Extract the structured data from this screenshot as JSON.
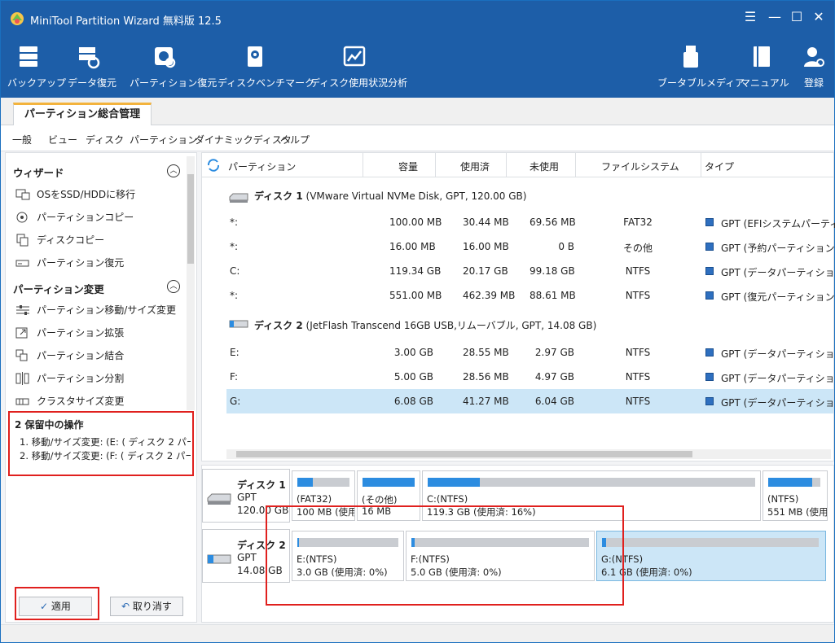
{
  "window": {
    "title": "MiniTool Partition Wizard 無料版 12.5"
  },
  "window_controls": {
    "menu": "☰",
    "minimize": "—",
    "maximize": "☐",
    "close": "✕"
  },
  "toolbar": [
    {
      "label": "バックアップ",
      "icon": "backup-icon"
    },
    {
      "label": "データ復元",
      "icon": "data-recovery-icon"
    },
    {
      "label": "パーティション復元",
      "icon": "partition-recovery-icon"
    },
    {
      "label": "ディスクベンチマーク",
      "icon": "disk-benchmark-icon"
    },
    {
      "label": "ディスク使用状況分析",
      "icon": "space-analyzer-icon"
    },
    {
      "label": "ブータブルメディア",
      "icon": "bootable-media-icon"
    },
    {
      "label": "マニュアル",
      "icon": "manual-icon"
    },
    {
      "label": "登録",
      "icon": "register-icon"
    }
  ],
  "tab": {
    "label": "パーティション総合管理"
  },
  "menu": [
    "一般",
    "ビュー",
    "ディスク",
    "パーティション",
    "ダイナミックディスク",
    "ヘルプ"
  ],
  "sidebar": {
    "wizard": {
      "title": "ウィザード",
      "items": [
        "OSをSSD/HDDに移行",
        "パーティションコピー",
        "ディスクコピー",
        "パーティション復元"
      ]
    },
    "change": {
      "title": "パーティション変更",
      "items": [
        "パーティション移動/サイズ変更",
        "パーティション拡張",
        "パーティション結合",
        "パーティション分割",
        "クラスタサイズ変更"
      ]
    },
    "pending": {
      "title": "2 保留中の操作",
      "ops": [
        "1. 移動/サイズ変更: (E: ( ディスク 2 パー...",
        "2. 移動/サイズ変更: (F: ( ディスク 2 パー..."
      ]
    },
    "apply_label": "適用",
    "undo_label": "取り消す"
  },
  "table": {
    "headers": [
      "パーティション",
      "容量",
      "使用済",
      "未使用",
      "ファイルシステム",
      "タイプ"
    ],
    "disk1": {
      "name": "ディスク 1",
      "desc": " (VMware Virtual NVMe Disk, GPT, 120.00 GB)"
    },
    "disk1_rows": [
      {
        "part": "*:",
        "cap": "100.00 MB",
        "used": "30.44 MB",
        "free": "69.56 MB",
        "fs": "FAT32",
        "type": "GPT (EFIシステムパーティション)"
      },
      {
        "part": "*:",
        "cap": "16.00 MB",
        "used": "16.00 MB",
        "free": "0 B",
        "fs": "その他",
        "type": "GPT (予約パーティション)"
      },
      {
        "part": "C:",
        "cap": "119.34 GB",
        "used": "20.17 GB",
        "free": "99.18 GB",
        "fs": "NTFS",
        "type": "GPT (データパーティション)"
      },
      {
        "part": "*:",
        "cap": "551.00 MB",
        "used": "462.39 MB",
        "free": "88.61 MB",
        "fs": "NTFS",
        "type": "GPT (復元パーティション)"
      }
    ],
    "disk2": {
      "name": "ディスク 2",
      "desc": " (JetFlash Transcend 16GB USB,リムーバブル, GPT, 14.08 GB)"
    },
    "disk2_rows": [
      {
        "part": "E:",
        "cap": "3.00 GB",
        "used": "28.55 MB",
        "free": "2.97 GB",
        "fs": "NTFS",
        "type": "GPT (データパーティション)"
      },
      {
        "part": "F:",
        "cap": "5.00 GB",
        "used": "28.56 MB",
        "free": "4.97 GB",
        "fs": "NTFS",
        "type": "GPT (データパーティション)"
      },
      {
        "part": "G:",
        "cap": "6.08 GB",
        "used": "41.27 MB",
        "free": "6.04 GB",
        "fs": "NTFS",
        "type": "GPT (データパーティション)"
      }
    ]
  },
  "diskmap": {
    "disk1": {
      "name": "ディスク 1",
      "style": "GPT",
      "size": "120.00 GB",
      "parts": [
        {
          "l1": "(FAT32)",
          "l2": "100 MB (使用",
          "fill": 0.3
        },
        {
          "l1": "(その他)",
          "l2": "16 MB",
          "fill": 1.0
        },
        {
          "l1": "C:(NTFS)",
          "l2": "119.3 GB (使用済: 16%)",
          "fill": 0.16
        },
        {
          "l1": "(NTFS)",
          "l2": "551 MB (使用",
          "fill": 0.84
        }
      ]
    },
    "disk2": {
      "name": "ディスク 2",
      "style": "GPT",
      "size": "14.08 GB",
      "parts": [
        {
          "l1": "E:(NTFS)",
          "l2": "3.0 GB (使用済: 0%)",
          "fill": 0.01
        },
        {
          "l1": "F:(NTFS)",
          "l2": "5.0 GB (使用済: 0%)",
          "fill": 0.01
        },
        {
          "l1": "G:(NTFS)",
          "l2": "6.1 GB (使用済: 0%)",
          "fill": 0.01
        }
      ]
    }
  }
}
